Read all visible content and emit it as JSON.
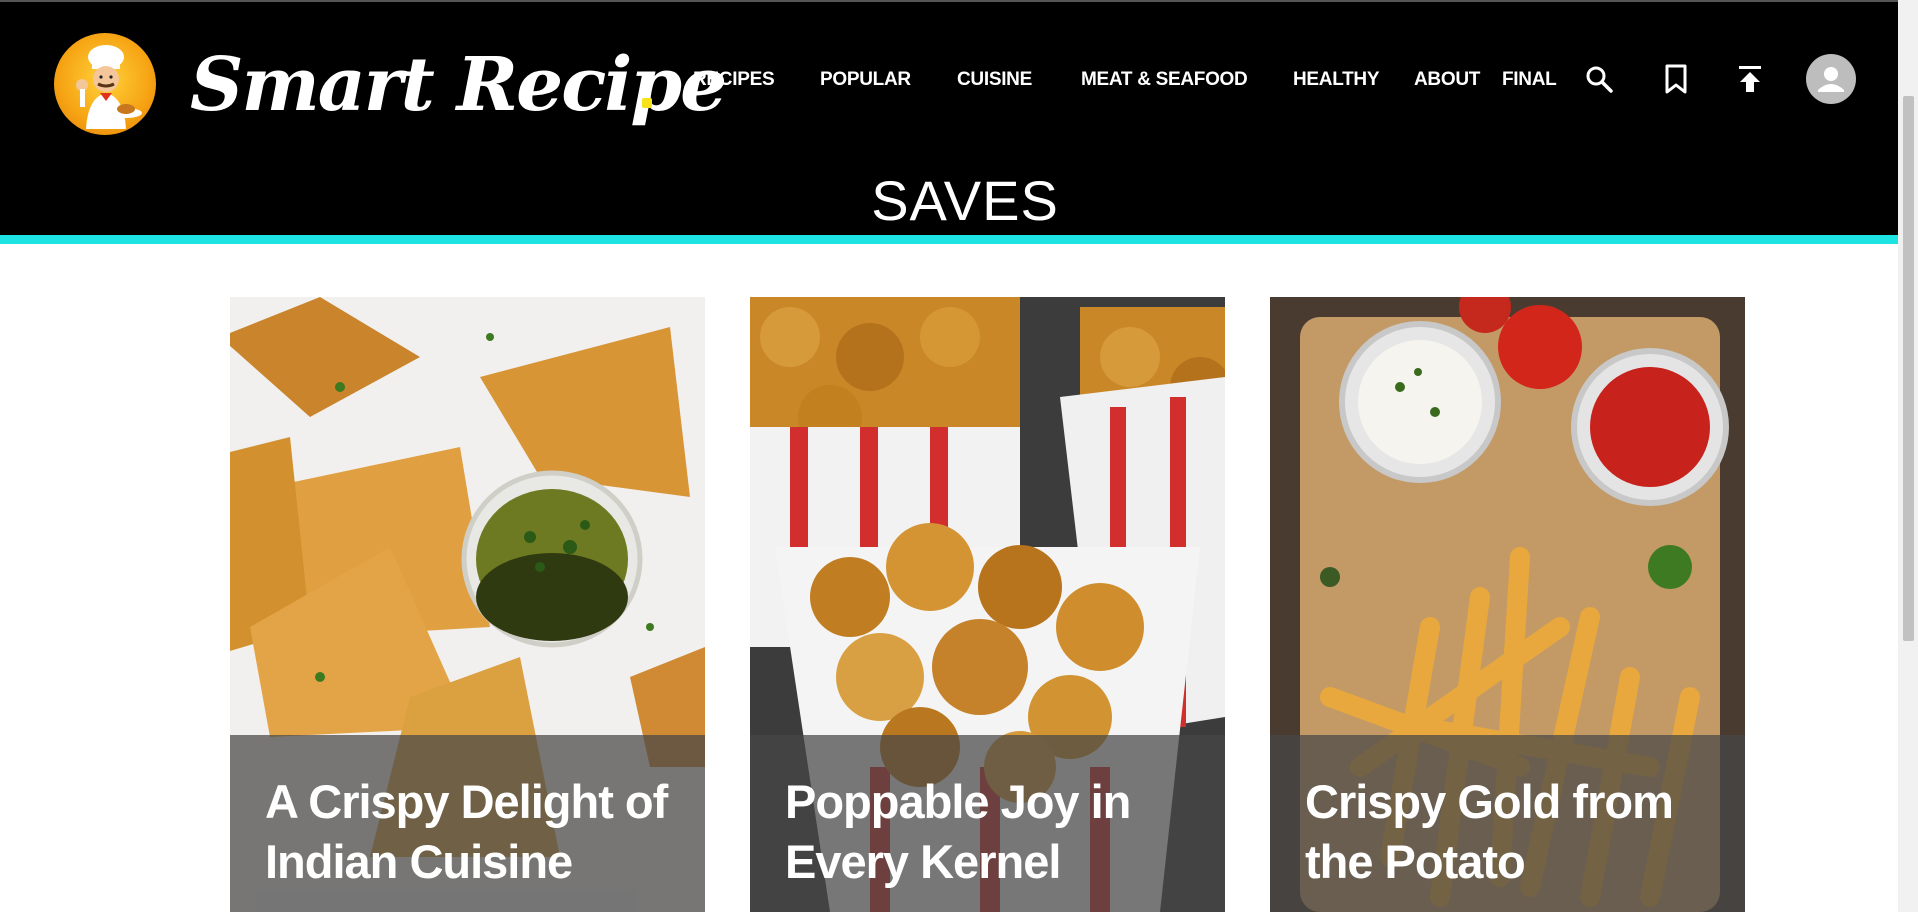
{
  "brand": {
    "name": "Smart Recipe"
  },
  "nav": {
    "items": [
      {
        "label": "RECIPES"
      },
      {
        "label": "POPULAR"
      },
      {
        "label": "CUISINE"
      },
      {
        "label": "MEAT & SEAFOOD"
      },
      {
        "label": "HEALTHY"
      },
      {
        "label": "ABOUT"
      },
      {
        "label": "FINAL"
      }
    ]
  },
  "icons": {
    "search": "search-icon",
    "bookmark": "bookmark-icon",
    "upload": "upload-icon",
    "avatar": "user-avatar-icon"
  },
  "page": {
    "title": "SAVES"
  },
  "cards": [
    {
      "title": "A Crispy Delight of Indian Cuisine",
      "image": "samosa-with-green-chutney"
    },
    {
      "title": "Poppable Joy in Every Kernel",
      "image": "caramel-popcorn-in-striped-boxes"
    },
    {
      "title": "Crispy Gold from the Potato",
      "image": "french-fries-with-mayo-and-ketchup"
    }
  ],
  "colors": {
    "header_bg": "#000000",
    "accent": "#1de3e3",
    "brand_dot": "#f7e21a",
    "text": "#ffffff"
  }
}
